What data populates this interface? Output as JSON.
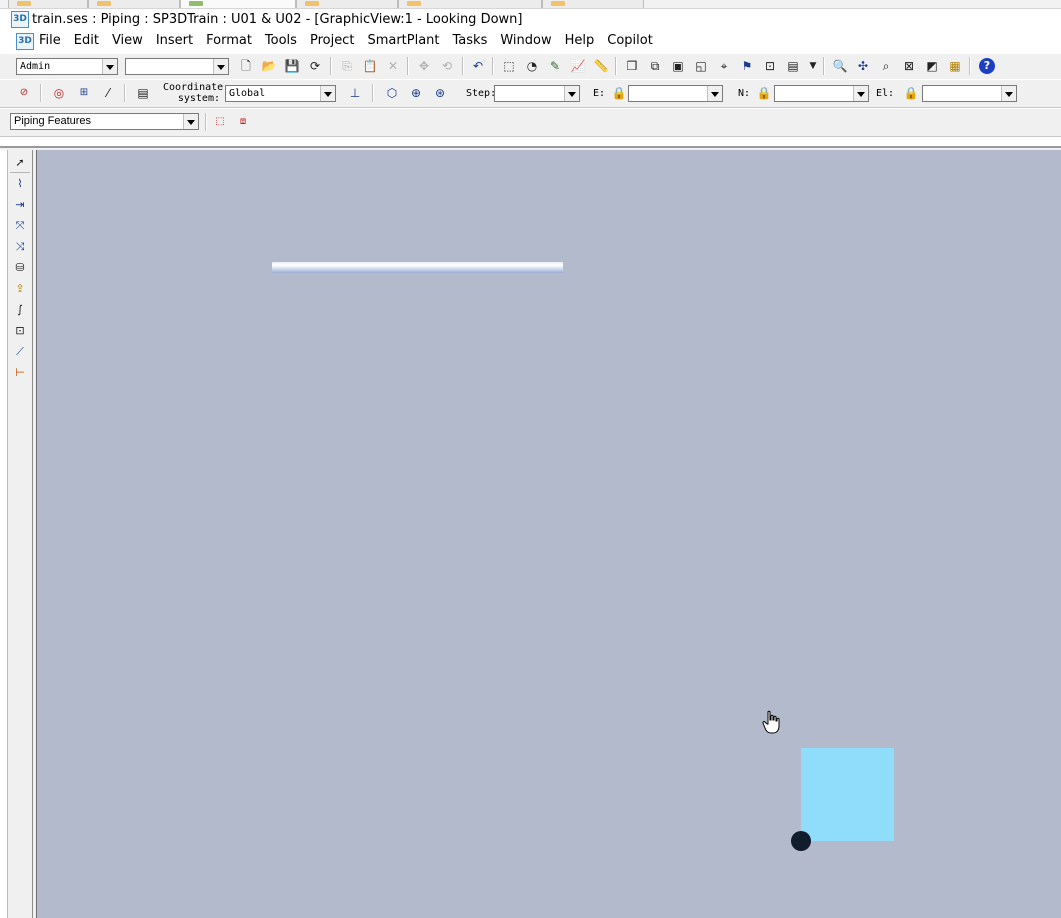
{
  "window": {
    "title": "train.ses : Piping : SP3DTrain : U01 & U02 - [GraphicView:1 - Looking Down]",
    "app_icon_text": "3D"
  },
  "menubar": {
    "items": [
      "File",
      "Edit",
      "View",
      "Insert",
      "Format",
      "Tools",
      "Project",
      "SmartPlant",
      "Tasks",
      "Window",
      "Help",
      "Copilot"
    ]
  },
  "toolbar1": {
    "permission_group": "Admin",
    "second_combo": ""
  },
  "toolbar2": {
    "coordinate_label_line1": "Coordinate",
    "coordinate_label_line2": "system:",
    "coordinate_system": "Global",
    "step_label": "Step:",
    "step_value": "",
    "e_label": "E:",
    "e_value": "",
    "n_label": "N:",
    "n_value": "",
    "el_label": "El:",
    "el_value": ""
  },
  "toolbar3": {
    "locate_filter": "Piping Features"
  },
  "view": {
    "background_color": "#b3bacb",
    "pipe_color": "#d3dcef",
    "selected_square_color": "#8fddfa",
    "point_marker_color": "#111d2c"
  }
}
